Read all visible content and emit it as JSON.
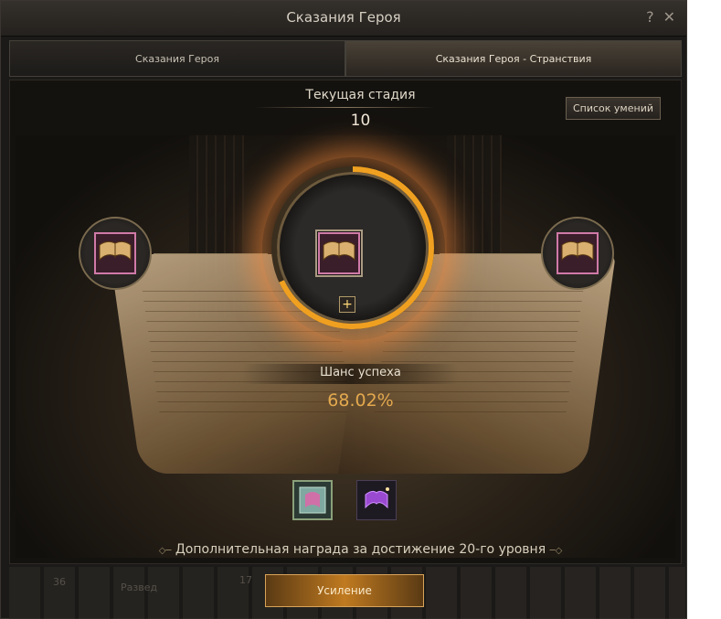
{
  "window": {
    "title": "Сказания Героя"
  },
  "titlebar_icons": {
    "help": "?",
    "close": "✕"
  },
  "tabs": [
    {
      "label": "Сказания Героя"
    },
    {
      "label": "Сказания Героя - Странствия"
    }
  ],
  "stage": {
    "label": "Текущая стадия",
    "value": "10"
  },
  "skills_button": {
    "label": "Список умений"
  },
  "center_slot": {
    "icon": "spellbook-icon",
    "plus": "+"
  },
  "progress_fraction": 0.68,
  "success": {
    "label": "Шанс успеха",
    "value": "68.02%"
  },
  "bonus": {
    "text": "Дополнительная награда за достижение 20-го уровня"
  },
  "enhance_button": {
    "label": "Усиление"
  },
  "background_hotbar": {
    "slot_a": "36",
    "slot_b": "Развед",
    "slot_c": "17"
  },
  "colors": {
    "accent": "#e3a94e",
    "progress": "#f0a020"
  }
}
